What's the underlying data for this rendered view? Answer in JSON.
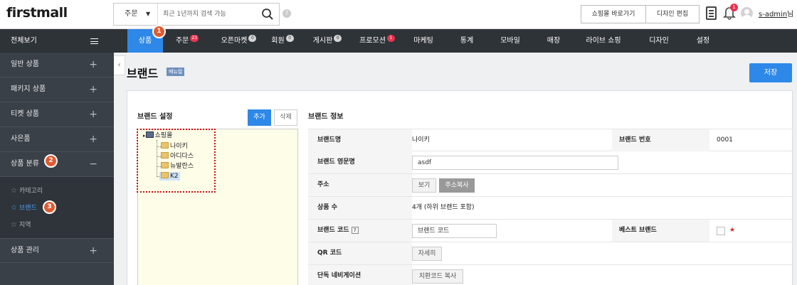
{
  "brand": {
    "logo": "firstmall"
  },
  "search": {
    "category": "주문",
    "placeholder": "최근 1년까지 검색 가능"
  },
  "help_mark": "?",
  "top_buttons": {
    "go_mall": "쇼핑몰 바로가기",
    "design_edit": "디자인 편집"
  },
  "notification_count": "1",
  "user": {
    "name": "s-admin",
    "suffix": "님"
  },
  "sidebar": {
    "header": "전체보기",
    "items": [
      {
        "label": "일반 상품",
        "toggle": "+"
      },
      {
        "label": "패키지 상품",
        "toggle": "+"
      },
      {
        "label": "티켓 상품",
        "toggle": "+"
      },
      {
        "label": "사은품",
        "toggle": "+"
      },
      {
        "label": "상품 분류",
        "toggle": "−"
      }
    ],
    "sub_items": [
      {
        "label": "카테고리",
        "active": false
      },
      {
        "label": "브랜드",
        "active": true
      },
      {
        "label": "지역",
        "active": false
      }
    ],
    "bottom_item": {
      "label": "상품 관리",
      "toggle": "+"
    }
  },
  "steps": [
    "1",
    "2",
    "3"
  ],
  "nav": {
    "tabs": [
      {
        "label": "상품",
        "count": "",
        "active": true
      },
      {
        "label": "주문",
        "count": "23",
        "badge": "red"
      },
      {
        "label": "오픈마켓",
        "count": "0",
        "badge": "gray"
      },
      {
        "label": "회원",
        "count": "0",
        "badge": "gray"
      },
      {
        "label": "게시판",
        "count": "0",
        "badge": "gray"
      },
      {
        "label": "프로모션",
        "count": "1",
        "badge": "red"
      },
      {
        "label": "마케팅",
        "count": ""
      },
      {
        "label": "통계",
        "count": ""
      },
      {
        "label": "모바일",
        "count": ""
      },
      {
        "label": "매장",
        "count": ""
      },
      {
        "label": "라이브 쇼핑",
        "count": ""
      },
      {
        "label": "디자인",
        "count": ""
      },
      {
        "label": "설정",
        "count": ""
      }
    ]
  },
  "page": {
    "title": "브랜드",
    "manual": "매뉴얼",
    "save": "저장",
    "collapse": "‹"
  },
  "brand_settings": {
    "title": "브랜드 설정",
    "add": "추가",
    "delete": "삭제",
    "tree": {
      "root": "쇼핑몰",
      "children": [
        "나이키",
        "아디다스",
        "뉴발란스",
        "K2"
      ]
    }
  },
  "brand_info": {
    "title": "브랜드 정보",
    "brand_name_label": "브랜드명",
    "brand_name": "나이키",
    "brand_no_label": "브랜드 번호",
    "brand_no": "0001",
    "english_name_label": "브랜드 영문명",
    "english_name": "asdf",
    "address_label": "주소",
    "view_btn": "보기",
    "copy_btn": "주소복사",
    "product_count_label": "상품 수",
    "product_count": "4개 (하위 브랜드 포함)",
    "brand_code_label": "브랜드 코드",
    "brand_code_placeholder": "브랜드 코드",
    "best_label": "베스트 브랜드",
    "best_star": "★",
    "qr_label": "QR 코드",
    "qr_btn": "자세히",
    "nav_label": "단독 네비게이션",
    "nav_btn": "치환코드 복사"
  }
}
